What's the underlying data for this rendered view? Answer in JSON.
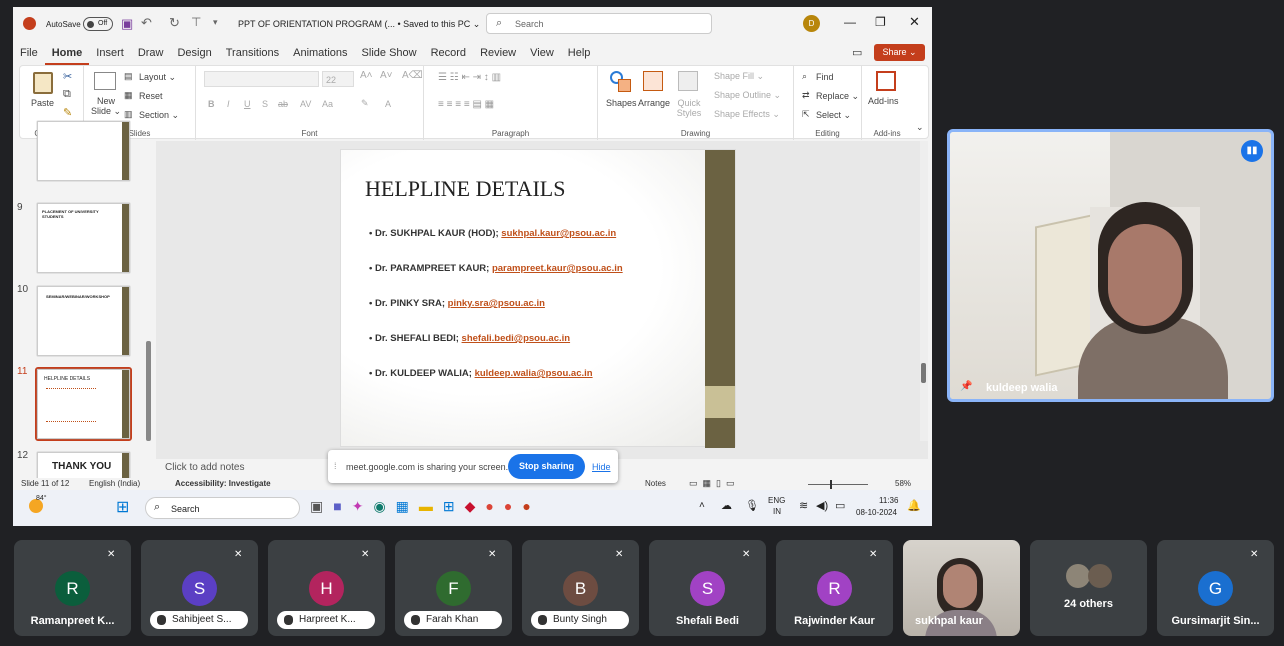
{
  "window": {
    "autosave_label": "AutoSave",
    "autosave_state": "Off",
    "doc_title": "PPT OF ORIENTATION PROGRAM (... • Saved to this PC ⌄",
    "search_placeholder": "Search",
    "avatar_letter": "D"
  },
  "tabs": [
    "File",
    "Home",
    "Insert",
    "Draw",
    "Design",
    "Transitions",
    "Animations",
    "Slide Show",
    "Record",
    "Review",
    "View",
    "Help"
  ],
  "share_label": "Share ⌄",
  "ribbon": {
    "paste": "Paste",
    "clipboard": "Clipboard",
    "new_slide": "New Slide ⌄",
    "layout": "Layout ⌄",
    "reset": "Reset",
    "section": "Section ⌄",
    "slides": "Slides",
    "font_size": "22",
    "font": "Font",
    "paragraph": "Paragraph",
    "shapes": "Shapes",
    "arrange": "Arrange",
    "quick_styles": "Quick Styles",
    "shape_fill": "Shape Fill ⌄",
    "shape_outline": "Shape Outline ⌄",
    "shape_effects": "Shape Effects ⌄",
    "drawing": "Drawing",
    "find": "Find",
    "replace": "Replace ⌄",
    "select": "Select ⌄",
    "editing": "Editing",
    "addins": "Add-ins",
    "addins_group": "Add-ins"
  },
  "thumbs": [
    {
      "num": "9",
      "title": "PLACEMENT OF UNIVERSITY STUDENTS"
    },
    {
      "num": "10",
      "title": "SEMINAR/WEBINAR/WORKSHOP"
    },
    {
      "num": "11",
      "title": "HELPLINE DETAILS"
    },
    {
      "num": "12",
      "title": "THANK YOU"
    }
  ],
  "slide": {
    "title": "HELPLINE DETAILS",
    "items": [
      {
        "name": "Dr. SUKHPAL KAUR (HOD);",
        "email": "sukhpal.kaur@psou.ac.in"
      },
      {
        "name": "Dr. PARAMPREET KAUR;",
        "email": "parampreet.kaur@psou.ac.in"
      },
      {
        "name": "Dr. PINKY SRA;",
        "email": "pinky.sra@psou.ac.in"
      },
      {
        "name": "Dr. SHEFALI BEDI;",
        "email": "shefali.bedi@psou.ac.in"
      },
      {
        "name": "Dr. KULDEEP WALIA;",
        "email": "kuldeep.walia@psou.ac.in"
      }
    ]
  },
  "notes_placeholder": "Click to add notes",
  "status": {
    "slide": "Slide 11 of 12",
    "lang": "English (India)",
    "accessibility": "Accessibility: Investigate",
    "notes": "Notes",
    "zoom": "58%"
  },
  "sharebar": {
    "text": "meet.google.com is sharing your screen.",
    "stop": "Stop sharing",
    "hide": "Hide"
  },
  "taskbar": {
    "temp": "84°",
    "search": "Search",
    "lang1": "ENG",
    "lang2": "IN",
    "time": "11:36",
    "date": "08-10-2024"
  },
  "video": {
    "name": "kuldeep walia"
  },
  "participants": [
    {
      "letter": "R",
      "name": "Ramanpreet K...",
      "color": "#0b5e3c",
      "pill": false
    },
    {
      "letter": "S",
      "name": "Sahibjeet S...",
      "color": "#5b3fc4",
      "pill": true
    },
    {
      "letter": "H",
      "name": "Harpreet K...",
      "color": "#b3245e",
      "pill": true
    },
    {
      "letter": "F",
      "name": "Farah Khan",
      "color": "#2f6b2f",
      "pill": true
    },
    {
      "letter": "B",
      "name": "Bunty Singh",
      "color": "#6d4c41",
      "pill": true
    },
    {
      "letter": "S",
      "name": "Shefali Bedi",
      "color": "#a142c4",
      "pill": false
    },
    {
      "letter": "R",
      "name": "Rajwinder Kaur",
      "color": "#a142c4",
      "pill": false
    },
    {
      "letter": "",
      "name": "sukhpal kaur",
      "color": "",
      "pill": false
    },
    {
      "letter": "",
      "name": "24 others",
      "color": "",
      "pill": false
    },
    {
      "letter": "G",
      "name": "Gursimarjit Sin...",
      "color": "#1a6fd0",
      "pill": false
    }
  ],
  "colors": {
    "accent": "#c43e1c",
    "link": "#c0501a",
    "meet_blue": "#1a73e8"
  }
}
